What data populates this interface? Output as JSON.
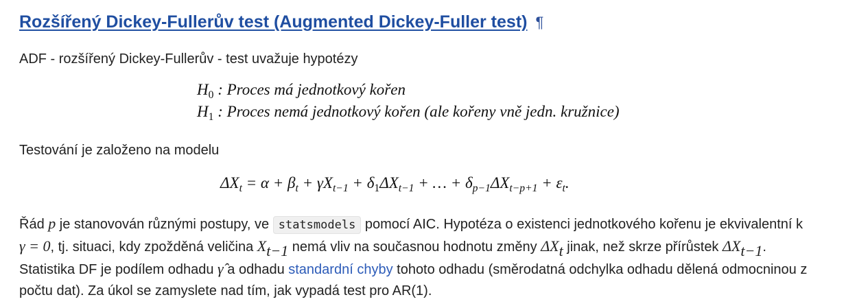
{
  "section": {
    "title": "Rozšířený Dickey-Fullerův test (Augmented Dickey-Fuller test)",
    "anchor": "¶"
  },
  "intro": "ADF - rozšířený Dickey-Fullerův - test uvažuje hypotézy",
  "hypotheses": {
    "h0_symbol": "H",
    "h0_index": "0",
    "h0_text": " : Proces má jednotkový kořen",
    "h1_symbol": "H",
    "h1_index": "1",
    "h1_text": " : Proces nemá jednotkový kořen (ale kořeny vně jedn. kružnice)"
  },
  "model_intro": "Testování je založeno na modelu",
  "model_equation": {
    "lhs": "ΔX",
    "lhs_sub": "t",
    "part1": " = α + β",
    "part1_sub": "t",
    "part2": " + γX",
    "part2_sub": "t−1",
    "part3": " + δ",
    "part3_sub": "1",
    "part4": "ΔX",
    "part4_sub": "t−1",
    "part5": " + … + δ",
    "part5_sub": "p−1",
    "part6": "ΔX",
    "part6_sub": "t−p+1",
    "part7": " + ε",
    "part7_sub": "t",
    "end": "."
  },
  "body": {
    "l1_a": "Řád ",
    "l1_p": "p",
    "l1_b": " je stanovován různými postupy, ve ",
    "l1_code": "statsmodels",
    "l1_c": " pomocí AIC. Hypotéza o existenci jednotkového kořenu je ekvivalentní k",
    "l2_gamma": "γ = 0",
    "l2_a": ", tj. situaci, kdy zpožděná veličina ",
    "l2_x": "X",
    "l2_x_sub": "t−1",
    "l2_b": " nemá vliv na současnou hodnotu změny ",
    "l2_dx": "ΔX",
    "l2_dx_sub": "t",
    "l2_c": " jinak, než skrze přírůstek ",
    "l2_dx2": "ΔX",
    "l2_dx2_sub": "t−1",
    "l2_end": ".",
    "l3_a": "Statistika DF je podílem odhadu ",
    "l3_gammahat": "γ̂",
    "l3_b": " a odhadu ",
    "l3_link": "standardní chyby",
    "l3_c": " tohoto odhadu (směrodatná odchylka odhadu dělená odmocninou z",
    "l4": "počtu dat). Za úkol se zamyslete nad tím, jak vypadá test pro AR(1)."
  },
  "colors": {
    "heading": "#1f4ea1",
    "link": "#2c5bb8",
    "text": "#222222",
    "code_bg": "#f0f0f0"
  }
}
